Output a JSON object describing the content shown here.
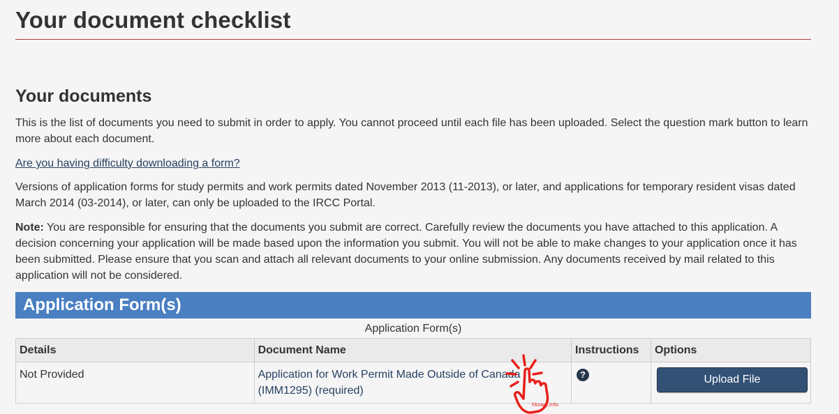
{
  "page": {
    "title": "Your document checklist"
  },
  "documents": {
    "heading": "Your documents",
    "intro": "This is the list of documents you need to submit in order to apply. You cannot proceed until each file has been uploaded. Select the question mark button to learn more about each document.",
    "help_link": "Are you having difficulty downloading a form?",
    "versions_text": "Versions of application forms for study permits and work permits dated November 2013 (11-2013), or later, and applications for temporary resident visas dated March 2014 (03-2014), or later, can only be uploaded to the IRCC Portal.",
    "note_label": "Note:",
    "note_text": " You are responsible for ensuring that the documents you submit are correct. Carefully review the documents you have attached to this application. A decision concerning your application will be made based upon the information you submit. You will not be able to make changes to your application once it has been submitted. Please ensure that you scan and attach all relevant documents to your online submission.  Any documents received by mail related to this application will not be considered."
  },
  "application_forms": {
    "panel_title": "Application Form(s)",
    "caption": "Application Form(s)",
    "headers": {
      "details": "Details",
      "document_name": "Document Name",
      "instructions": "Instructions",
      "options": "Options"
    },
    "rows": [
      {
        "details": "Not Provided",
        "document_name": "Application for Work Permit Made Outside of Canada (IMM1295)  (required)",
        "instructions_icon": "question-circle-icon",
        "instructions_glyph": "?",
        "option_label": "Upload File"
      }
    ]
  },
  "watermark": {
    "text": "hkowp.info",
    "icon": "tap-hand-icon",
    "color": "#e8201a"
  },
  "colors": {
    "panel_heading": "#4a7fc1",
    "link": "#284162",
    "button": "#335075",
    "title_rule": "#af3c43"
  }
}
